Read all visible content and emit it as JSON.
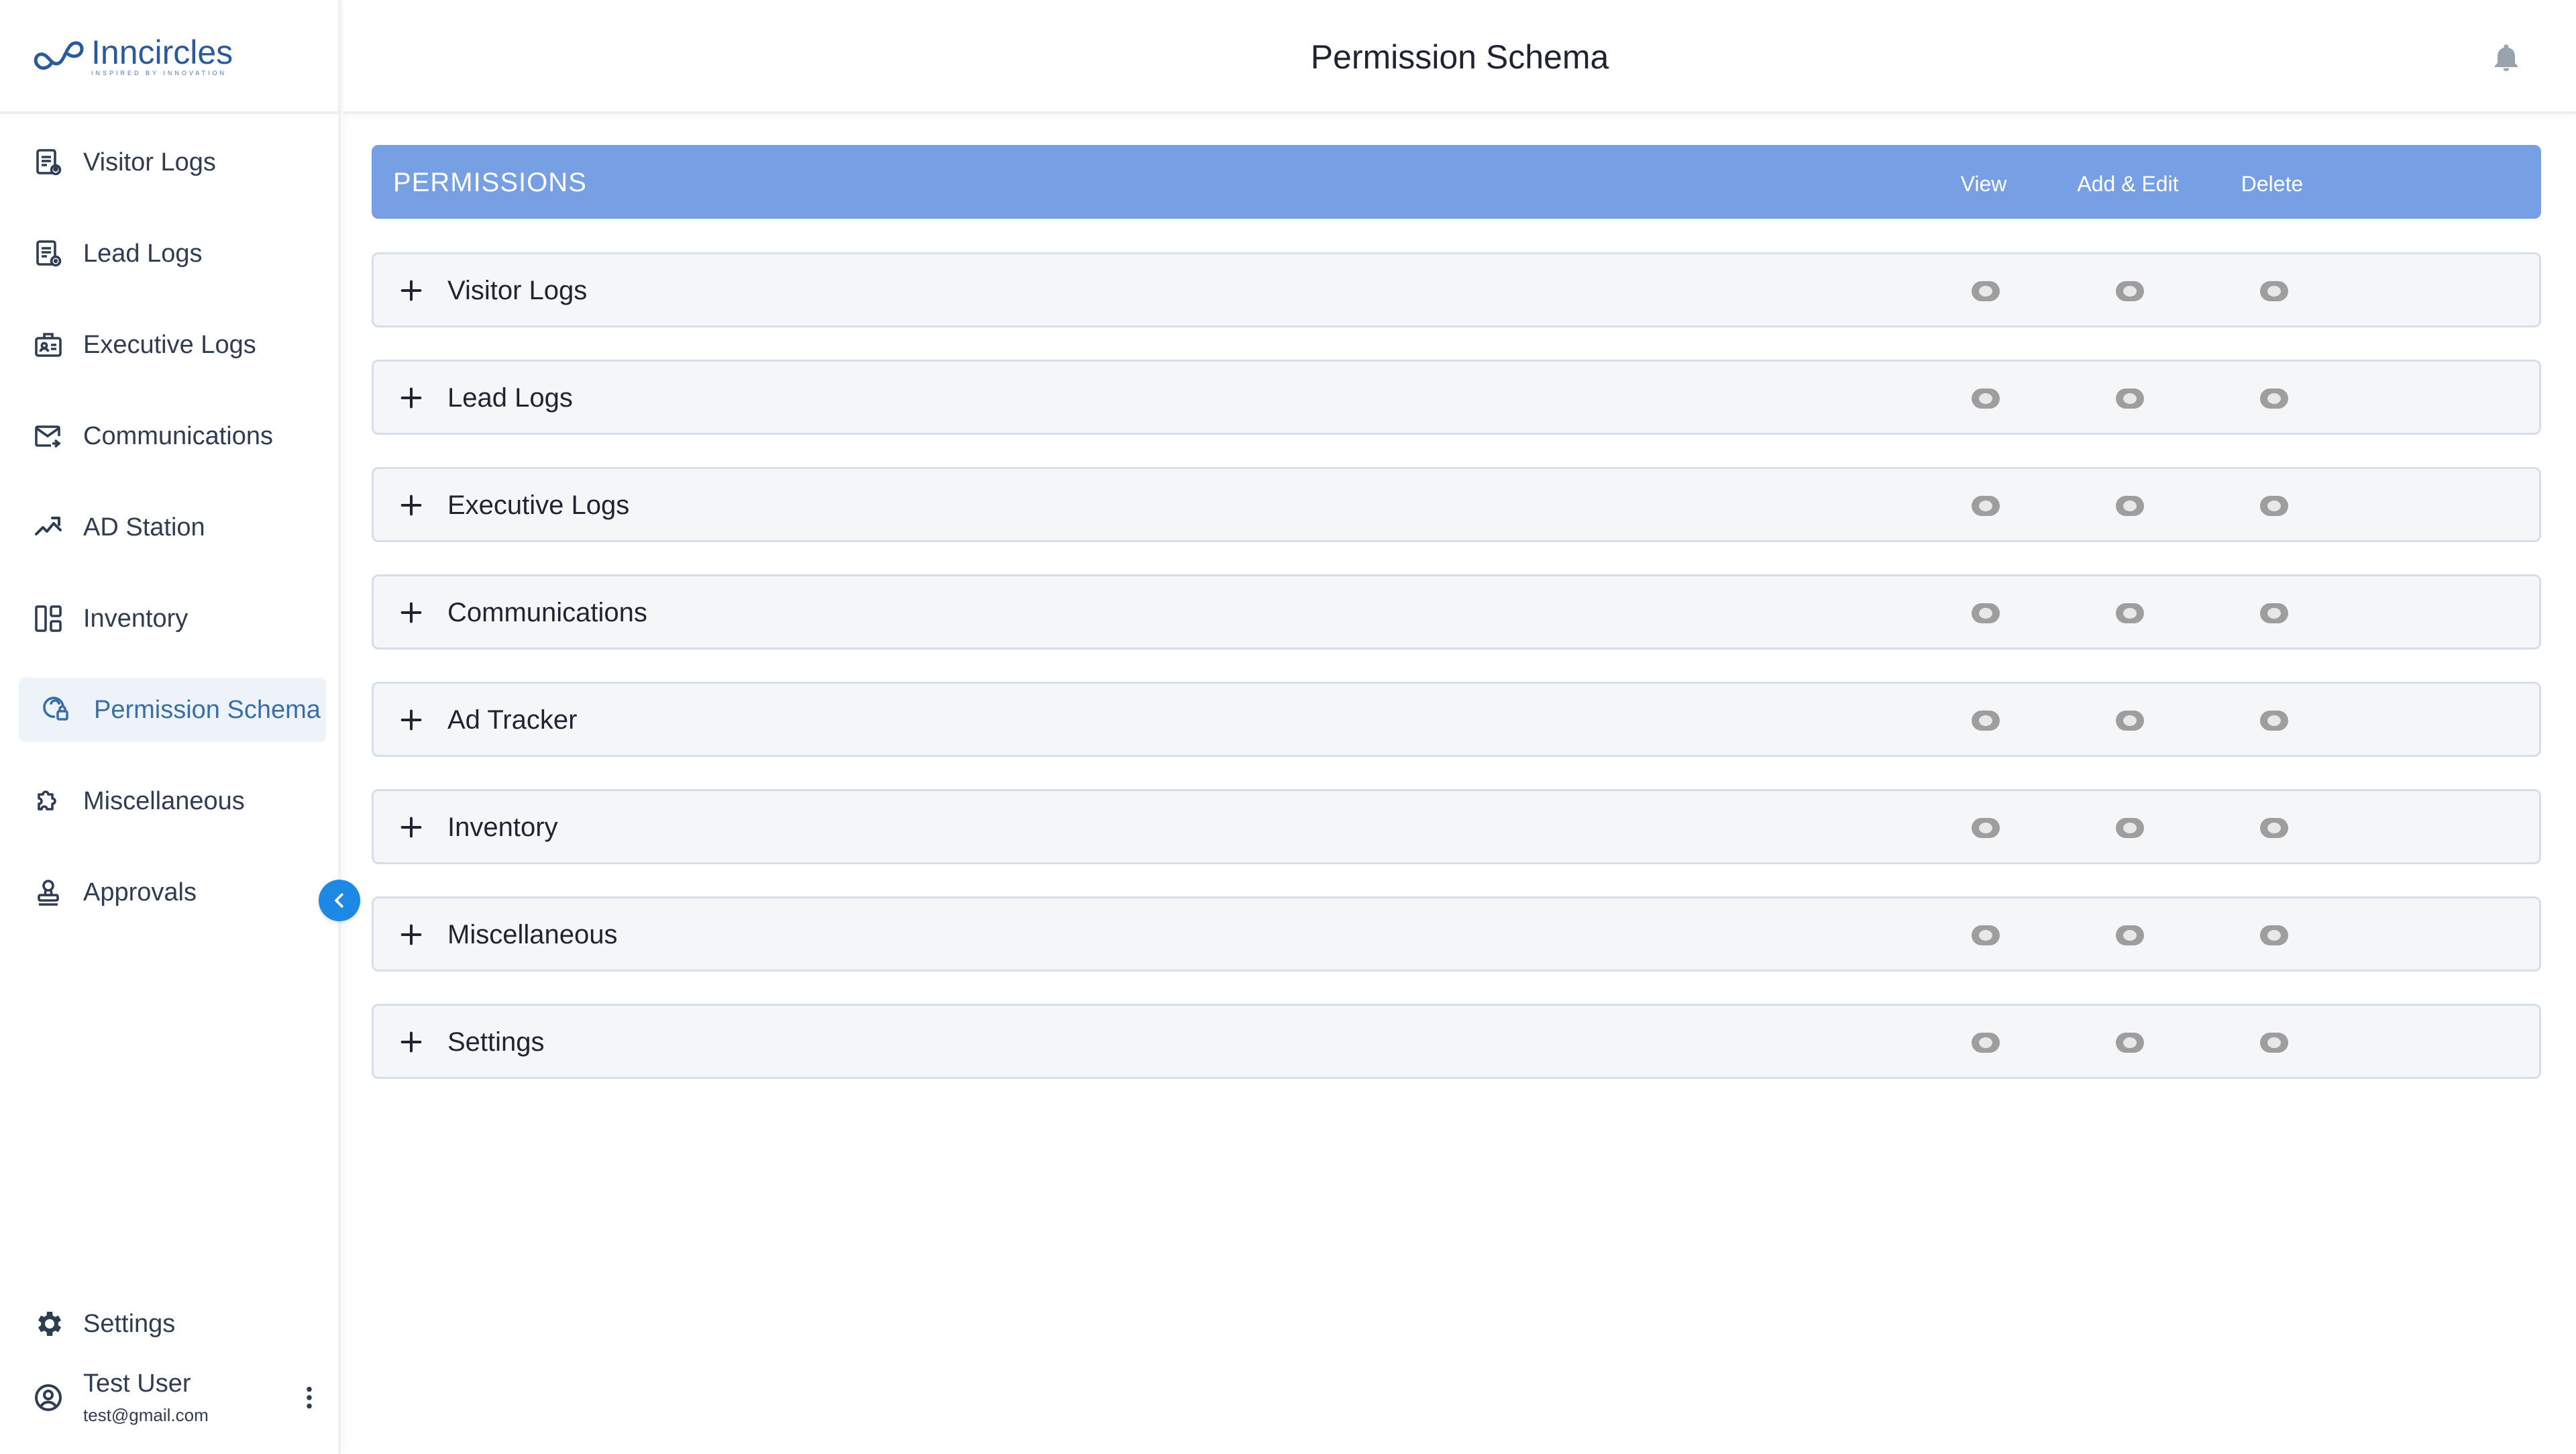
{
  "brand": {
    "name": "Inncircles",
    "tagline": "INSPIRED BY INNOVATION",
    "colors": {
      "primary": "#2a5a9c",
      "accent": "#1e88e5",
      "header_bar": "#76a0e3"
    }
  },
  "header": {
    "title": "Permission Schema",
    "notification_icon": "bell-icon"
  },
  "sidebar": {
    "items": [
      {
        "label": "Visitor Logs",
        "icon": "visitor-logs-icon"
      },
      {
        "label": "Lead Logs",
        "icon": "lead-logs-icon"
      },
      {
        "label": "Executive Logs",
        "icon": "executive-logs-icon"
      },
      {
        "label": "Communications",
        "icon": "mail-icon"
      },
      {
        "label": "AD Station",
        "icon": "trend-icon"
      },
      {
        "label": "Inventory",
        "icon": "inventory-icon"
      },
      {
        "label": "Permission Schema",
        "icon": "permission-icon",
        "active": true
      },
      {
        "label": "Miscellaneous",
        "icon": "puzzle-icon"
      },
      {
        "label": "Approvals",
        "icon": "stamp-icon"
      }
    ],
    "settings_label": "Settings",
    "collapse_icon": "chevron-left-icon",
    "user": {
      "name": "Test User",
      "email": "test@gmail.com"
    }
  },
  "permissions": {
    "title": "PERMISSIONS",
    "columns": [
      "View",
      "Add & Edit",
      "Delete"
    ],
    "rows": [
      {
        "label": "Visitor Logs",
        "view": false,
        "add_edit": false,
        "delete": false
      },
      {
        "label": "Lead Logs",
        "view": false,
        "add_edit": false,
        "delete": false
      },
      {
        "label": "Executive Logs",
        "view": false,
        "add_edit": false,
        "delete": false
      },
      {
        "label": "Communications",
        "view": false,
        "add_edit": false,
        "delete": false
      },
      {
        "label": "Ad Tracker",
        "view": false,
        "add_edit": false,
        "delete": false
      },
      {
        "label": "Inventory",
        "view": false,
        "add_edit": false,
        "delete": false
      },
      {
        "label": "Miscellaneous",
        "view": false,
        "add_edit": false,
        "delete": false
      },
      {
        "label": "Settings",
        "view": false,
        "add_edit": false,
        "delete": false
      }
    ]
  }
}
